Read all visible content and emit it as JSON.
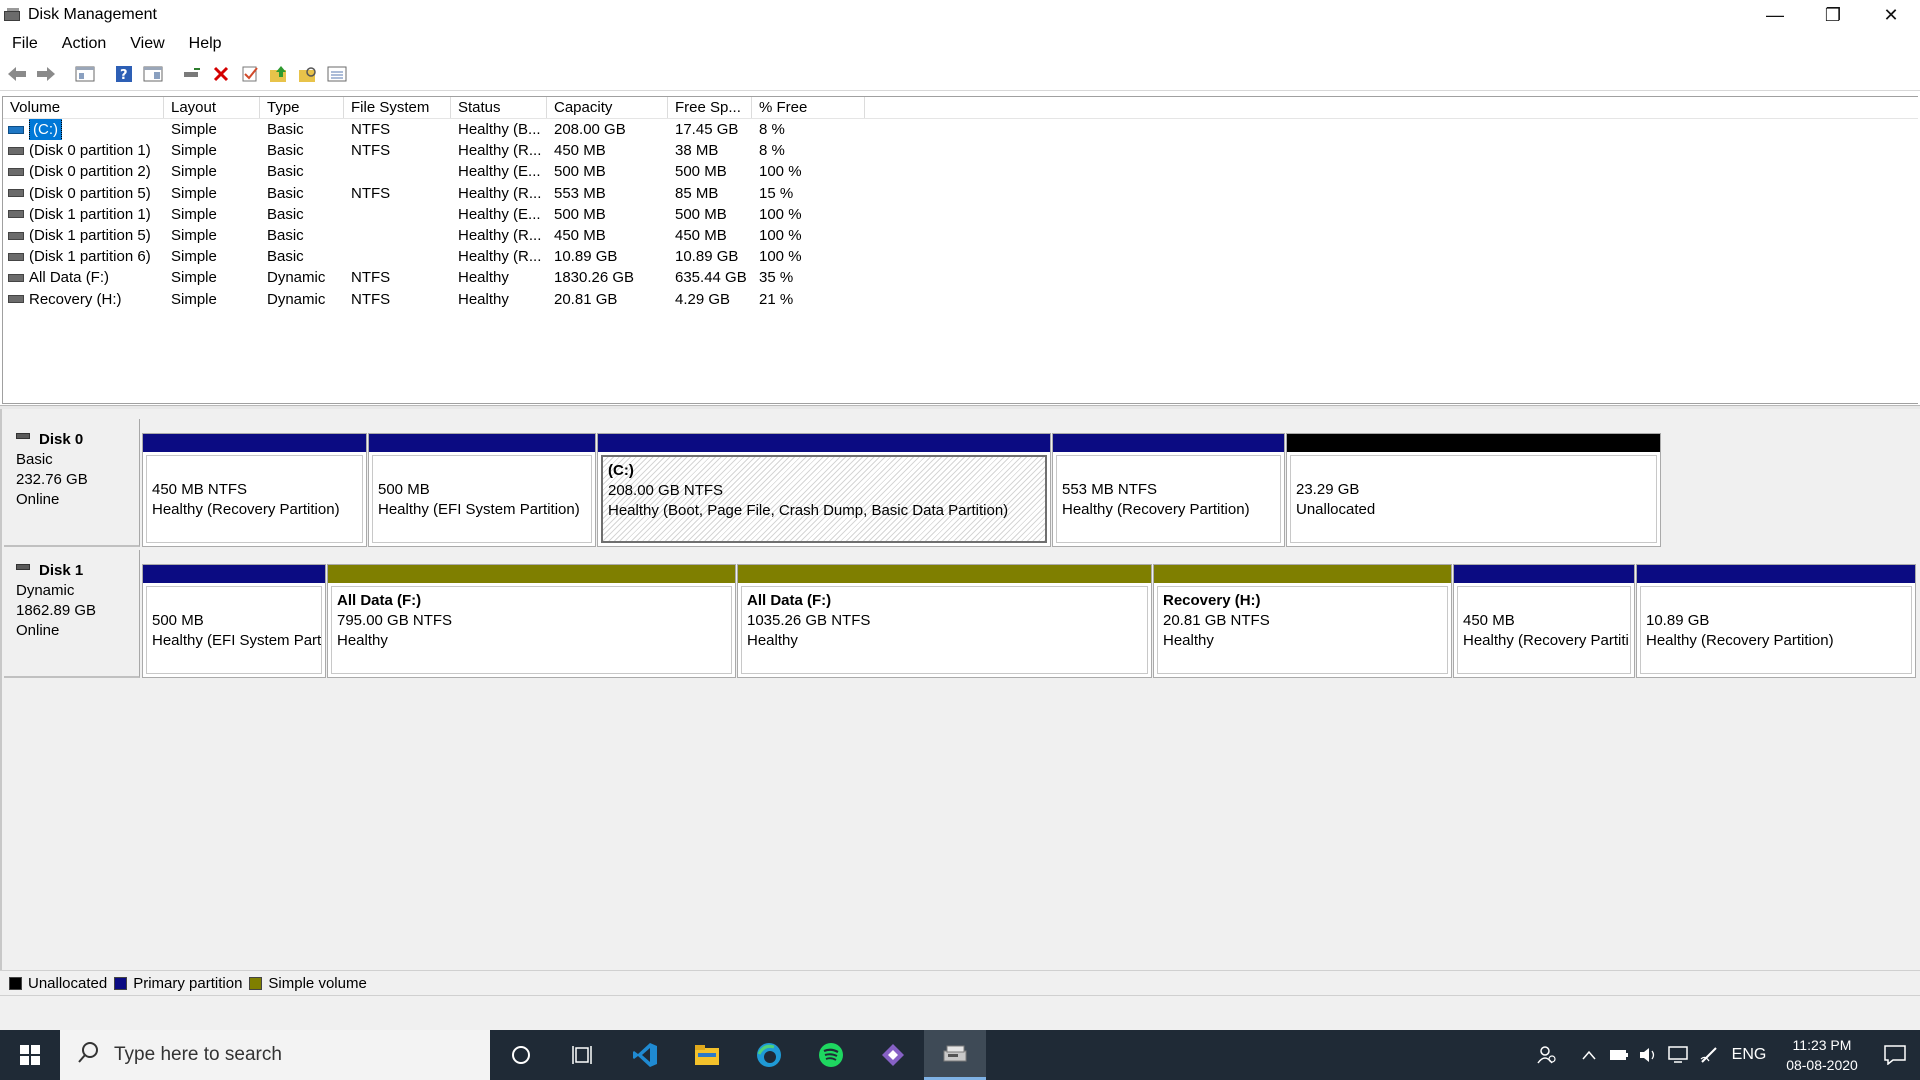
{
  "window": {
    "title": "Disk Management",
    "minimize": "—",
    "restore": "❐",
    "close": "✕"
  },
  "menu": [
    "File",
    "Action",
    "View",
    "Help"
  ],
  "toolbar_icons": [
    "back-arrow-icon",
    "forward-arrow-icon",
    "console-tree-icon",
    "help-icon",
    "properties-icon",
    "connect-icon",
    "delete-icon",
    "check-icon",
    "folder-up-icon",
    "folder-search-icon",
    "list-view-icon"
  ],
  "volume_list": {
    "columns": [
      "Volume",
      "Layout",
      "Type",
      "File System",
      "Status",
      "Capacity",
      "Free Sp...",
      "% Free"
    ],
    "rows": [
      {
        "volume": "(C:)",
        "layout": "Simple",
        "type": "Basic",
        "fs": "NTFS",
        "status": "Healthy (B...",
        "capacity": "208.00 GB",
        "free": "17.45 GB",
        "pct": "8 %",
        "selected": true
      },
      {
        "volume": "(Disk 0 partition 1)",
        "layout": "Simple",
        "type": "Basic",
        "fs": "NTFS",
        "status": "Healthy (R...",
        "capacity": "450 MB",
        "free": "38 MB",
        "pct": "8 %"
      },
      {
        "volume": "(Disk 0 partition 2)",
        "layout": "Simple",
        "type": "Basic",
        "fs": "",
        "status": "Healthy (E...",
        "capacity": "500 MB",
        "free": "500 MB",
        "pct": "100 %"
      },
      {
        "volume": "(Disk 0 partition 5)",
        "layout": "Simple",
        "type": "Basic",
        "fs": "NTFS",
        "status": "Healthy (R...",
        "capacity": "553 MB",
        "free": "85 MB",
        "pct": "15 %"
      },
      {
        "volume": "(Disk 1 partition 1)",
        "layout": "Simple",
        "type": "Basic",
        "fs": "",
        "status": "Healthy (E...",
        "capacity": "500 MB",
        "free": "500 MB",
        "pct": "100 %"
      },
      {
        "volume": "(Disk 1 partition 5)",
        "layout": "Simple",
        "type": "Basic",
        "fs": "",
        "status": "Healthy (R...",
        "capacity": "450 MB",
        "free": "450 MB",
        "pct": "100 %"
      },
      {
        "volume": "(Disk 1 partition 6)",
        "layout": "Simple",
        "type": "Basic",
        "fs": "",
        "status": "Healthy (R...",
        "capacity": "10.89 GB",
        "free": "10.89 GB",
        "pct": "100 %"
      },
      {
        "volume": "All Data (F:)",
        "layout": "Simple",
        "type": "Dynamic",
        "fs": "NTFS",
        "status": "Healthy",
        "capacity": "1830.26 GB",
        "free": "635.44 GB",
        "pct": "35 %"
      },
      {
        "volume": "Recovery (H:)",
        "layout": "Simple",
        "type": "Dynamic",
        "fs": "NTFS",
        "status": "Healthy",
        "capacity": "20.81 GB",
        "free": "4.29 GB",
        "pct": "21 %"
      }
    ]
  },
  "disks": [
    {
      "name": "Disk 0",
      "type": "Basic",
      "size": "232.76 GB",
      "state": "Online",
      "partitions": [
        {
          "label": "",
          "size": "450 MB NTFS",
          "status": "Healthy (Recovery Partition)",
          "kind": "primary"
        },
        {
          "label": "",
          "size": "500 MB",
          "status": "Healthy (EFI System Partition)",
          "kind": "primary"
        },
        {
          "label": "(C:)",
          "size": "208.00 GB NTFS",
          "status": "Healthy (Boot, Page File, Crash Dump, Basic Data Partition)",
          "kind": "primary",
          "selected": true
        },
        {
          "label": "",
          "size": "553 MB NTFS",
          "status": "Healthy (Recovery Partition)",
          "kind": "primary"
        },
        {
          "label": "",
          "size": "23.29 GB",
          "status": "Unallocated",
          "kind": "unallocated"
        }
      ]
    },
    {
      "name": "Disk 1",
      "type": "Dynamic",
      "size": "1862.89 GB",
      "state": "Online",
      "partitions": [
        {
          "label": "",
          "size": "500 MB",
          "status": "Healthy (EFI System Parti",
          "kind": "primary"
        },
        {
          "label": "All Data  (F:)",
          "size": "795.00 GB NTFS",
          "status": "Healthy",
          "kind": "simple"
        },
        {
          "label": "All Data  (F:)",
          "size": "1035.26 GB NTFS",
          "status": "Healthy",
          "kind": "simple"
        },
        {
          "label": "Recovery  (H:)",
          "size": "20.81 GB NTFS",
          "status": "Healthy",
          "kind": "simple"
        },
        {
          "label": "",
          "size": "450 MB",
          "status": "Healthy (Recovery Partiti",
          "kind": "primary"
        },
        {
          "label": "",
          "size": "10.89 GB",
          "status": "Healthy (Recovery Partition)",
          "kind": "primary"
        }
      ]
    }
  ],
  "legend": [
    {
      "label": "Unallocated",
      "color": "#000000"
    },
    {
      "label": "Primary partition",
      "color": "#0b0b82"
    },
    {
      "label": "Simple volume",
      "color": "#7f7f00"
    }
  ],
  "colors": {
    "primary": "#0b0b82",
    "simple": "#7f7f00",
    "unallocated": "#000000",
    "selection": "#0078d7"
  },
  "taskbar": {
    "search_placeholder": "Type here to search",
    "apps": [
      "cortana-icon",
      "task-view-icon",
      "vscode-icon",
      "file-explorer-icon",
      "edge-icon",
      "spotify-icon",
      "visual-studio-icon",
      "disk-management-icon"
    ],
    "tray": {
      "language": "ENG",
      "time": "11:23 PM",
      "date": "08-08-2020"
    }
  }
}
